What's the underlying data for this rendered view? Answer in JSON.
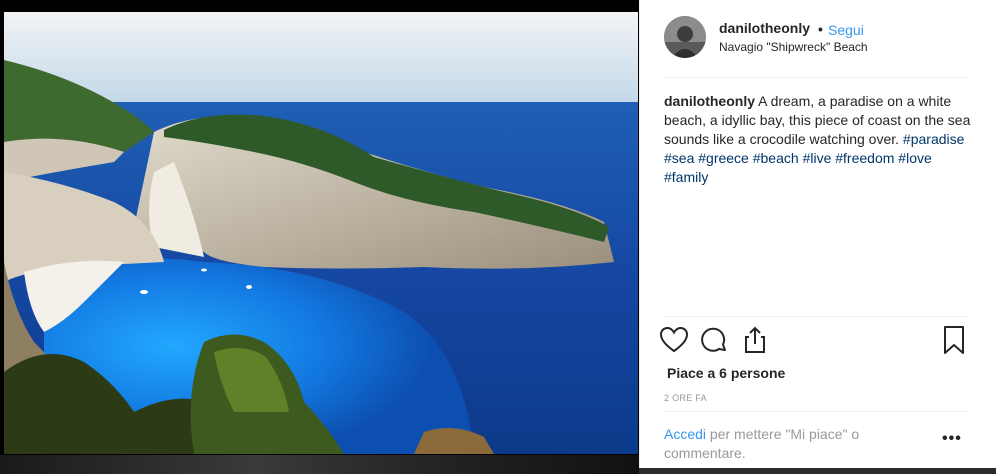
{
  "post": {
    "username": "danilotheonly",
    "separator": "•",
    "follow_label": "Segui",
    "location": "Navagio \"Shipwreck\" Beach",
    "caption_user": "danilotheonly",
    "caption_text": " A dream, a paradise on a white beach, a idyllic bay, this piece of coast on the sea sounds like a crocodile watching over. ",
    "hashtags": [
      "#paradise",
      "#sea",
      "#greece",
      "#beach",
      "#live",
      "#freedom",
      "#love",
      "#family"
    ],
    "likes": "Piace a 6 persone",
    "time": "2 ORE FA",
    "login_link": "Accedi",
    "login_text": " per mettere \"Mi piace\" o commentare.",
    "more": "•••"
  },
  "icons": {
    "like": "heart-icon",
    "comment": "comment-icon",
    "share": "share-icon",
    "save": "bookmark-icon",
    "more": "more-options-icon"
  },
  "colors": {
    "link_blue": "#3897f0",
    "hashtag": "#003569",
    "text": "#262626",
    "muted": "#999999"
  }
}
